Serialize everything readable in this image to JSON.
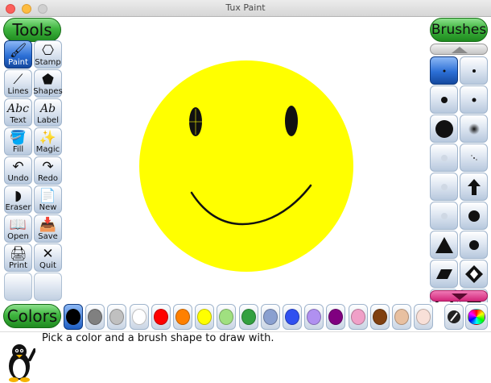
{
  "window": {
    "title": "Tux Paint"
  },
  "tools_header": "Tools",
  "brushes_header": "Brushes",
  "colors_header": "Colors",
  "tools": [
    {
      "id": "paint",
      "label": "Paint",
      "icon": "paintbrush-icon",
      "glyph": "🖌",
      "selected": true
    },
    {
      "id": "stamp",
      "label": "Stamp",
      "icon": "stamp-icon",
      "glyph": "⎔",
      "selected": false
    },
    {
      "id": "lines",
      "label": "Lines",
      "icon": "lines-icon",
      "glyph": "⟋",
      "selected": false
    },
    {
      "id": "shapes",
      "label": "Shapes",
      "icon": "pentagon-icon",
      "glyph": "⬟",
      "selected": false
    },
    {
      "id": "text",
      "label": "Text",
      "icon": "text-icon",
      "glyph": "Abc",
      "selected": false
    },
    {
      "id": "label",
      "label": "Label",
      "icon": "label-icon",
      "glyph": "Ab",
      "selected": false
    },
    {
      "id": "fill",
      "label": "Fill",
      "icon": "paint-bucket-icon",
      "glyph": "🪣",
      "selected": false
    },
    {
      "id": "magic",
      "label": "Magic",
      "icon": "magic-wand-icon",
      "glyph": "✨",
      "selected": false
    },
    {
      "id": "undo",
      "label": "Undo",
      "icon": "undo-icon",
      "glyph": "↶",
      "selected": false
    },
    {
      "id": "redo",
      "label": "Redo",
      "icon": "redo-icon",
      "glyph": "↷",
      "selected": false
    },
    {
      "id": "eraser",
      "label": "Eraser",
      "icon": "eraser-icon",
      "glyph": "◗",
      "selected": false
    },
    {
      "id": "new",
      "label": "New",
      "icon": "new-page-icon",
      "glyph": "📄",
      "selected": false
    },
    {
      "id": "open",
      "label": "Open",
      "icon": "open-book-icon",
      "glyph": "📖",
      "selected": false
    },
    {
      "id": "save",
      "label": "Save",
      "icon": "save-icon",
      "glyph": "📥",
      "selected": false
    },
    {
      "id": "print",
      "label": "Print",
      "icon": "printer-icon",
      "glyph": "🖨",
      "selected": false
    },
    {
      "id": "quit",
      "label": "Quit",
      "icon": "quit-x-icon",
      "glyph": "✕",
      "selected": false
    }
  ],
  "brushes": [
    {
      "id": "b1",
      "icon": "brush-tiny-dot-icon",
      "selected": true
    },
    {
      "id": "b2",
      "icon": "brush-small-dot-icon",
      "selected": false
    },
    {
      "id": "b3",
      "icon": "brush-medium-dot-icon",
      "selected": false
    },
    {
      "id": "b4",
      "icon": "brush-small-dot-2-icon",
      "selected": false
    },
    {
      "id": "b5",
      "icon": "brush-large-dot-icon",
      "selected": false
    },
    {
      "id": "b6",
      "icon": "brush-soft-dot-icon",
      "selected": false
    },
    {
      "id": "b7",
      "icon": "brush-faint-dot-icon",
      "selected": false
    },
    {
      "id": "b8",
      "icon": "brush-speckle-icon",
      "selected": false
    },
    {
      "id": "b9",
      "icon": "brush-faint-dot-2-icon",
      "selected": false
    },
    {
      "id": "b10",
      "icon": "brush-arrow-up-icon",
      "selected": false
    },
    {
      "id": "b11",
      "icon": "brush-faint-dot-3-icon",
      "selected": false
    },
    {
      "id": "b12",
      "icon": "brush-dot-icon",
      "selected": false
    },
    {
      "id": "b13",
      "icon": "brush-triangle-icon",
      "selected": false
    },
    {
      "id": "b14",
      "icon": "brush-dot-2-icon",
      "selected": false
    },
    {
      "id": "b15",
      "icon": "brush-parallelogram-icon",
      "selected": false
    },
    {
      "id": "b16",
      "icon": "brush-diamond-arrows-icon",
      "selected": false
    },
    {
      "id": "b17",
      "icon": "brush-star-icon",
      "selected": false
    },
    {
      "id": "b18",
      "icon": "brush-diamond-icon",
      "selected": false
    }
  ],
  "colors": [
    {
      "name": "black",
      "hex": "#000000",
      "selected": true
    },
    {
      "name": "dark-gray",
      "hex": "#808080",
      "selected": false
    },
    {
      "name": "light-gray",
      "hex": "#c0c0c0",
      "selected": false
    },
    {
      "name": "white",
      "hex": "#ffffff",
      "selected": false
    },
    {
      "name": "red",
      "hex": "#ff0000",
      "selected": false
    },
    {
      "name": "orange",
      "hex": "#ff8000",
      "selected": false
    },
    {
      "name": "yellow",
      "hex": "#ffff00",
      "selected": false
    },
    {
      "name": "light-green",
      "hex": "#a0e080",
      "selected": false
    },
    {
      "name": "green",
      "hex": "#33a040",
      "selected": false
    },
    {
      "name": "slate-blue",
      "hex": "#8aa0d0",
      "selected": false
    },
    {
      "name": "blue",
      "hex": "#3050f0",
      "selected": false
    },
    {
      "name": "lavender",
      "hex": "#b090f0",
      "selected": false
    },
    {
      "name": "purple",
      "hex": "#800080",
      "selected": false
    },
    {
      "name": "pink",
      "hex": "#f0a0c8",
      "selected": false
    },
    {
      "name": "brown",
      "hex": "#804010",
      "selected": false
    },
    {
      "name": "tan",
      "hex": "#e8c0a0",
      "selected": false
    },
    {
      "name": "peach",
      "hex": "#f8e0d8",
      "selected": false
    }
  ],
  "status": {
    "message": "Pick a color and a brush shape to draw with."
  }
}
